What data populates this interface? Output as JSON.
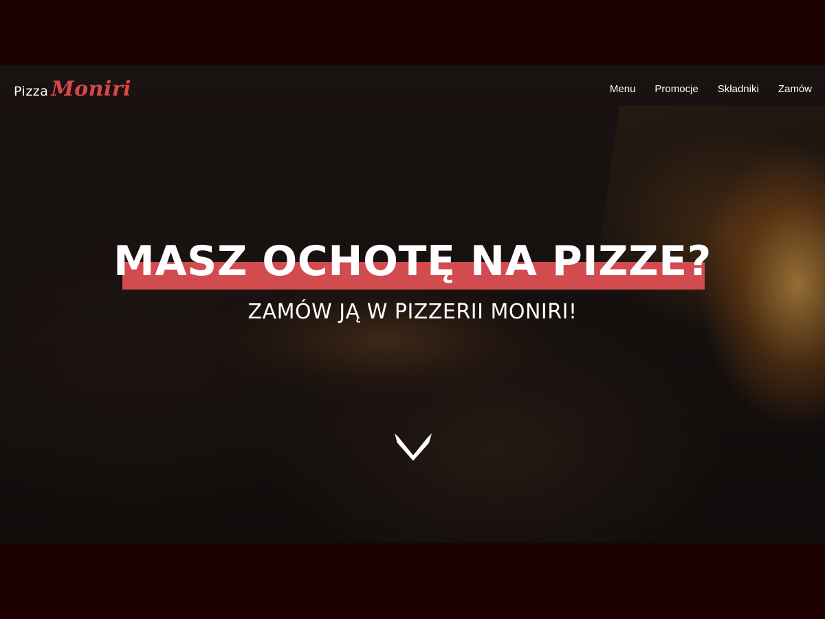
{
  "brand": {
    "name_part1": "Pizza",
    "name_part2": "Moniri",
    "accent_color": "#d24b4f"
  },
  "nav": {
    "items": [
      {
        "label": "Menu"
      },
      {
        "label": "Promocje"
      },
      {
        "label": "Składniki"
      },
      {
        "label": "Zamów"
      }
    ]
  },
  "hero": {
    "headline": "MASZ OCHOTĘ NA PIZZE?",
    "subheadline": "ZAMÓW JĄ W PIZZERII MONIRI!",
    "scroll_icon": "chevron-down-icon"
  },
  "colors": {
    "letterbox": "#1c0002",
    "text": "#ffffff",
    "highlight": "#d24b4f"
  }
}
